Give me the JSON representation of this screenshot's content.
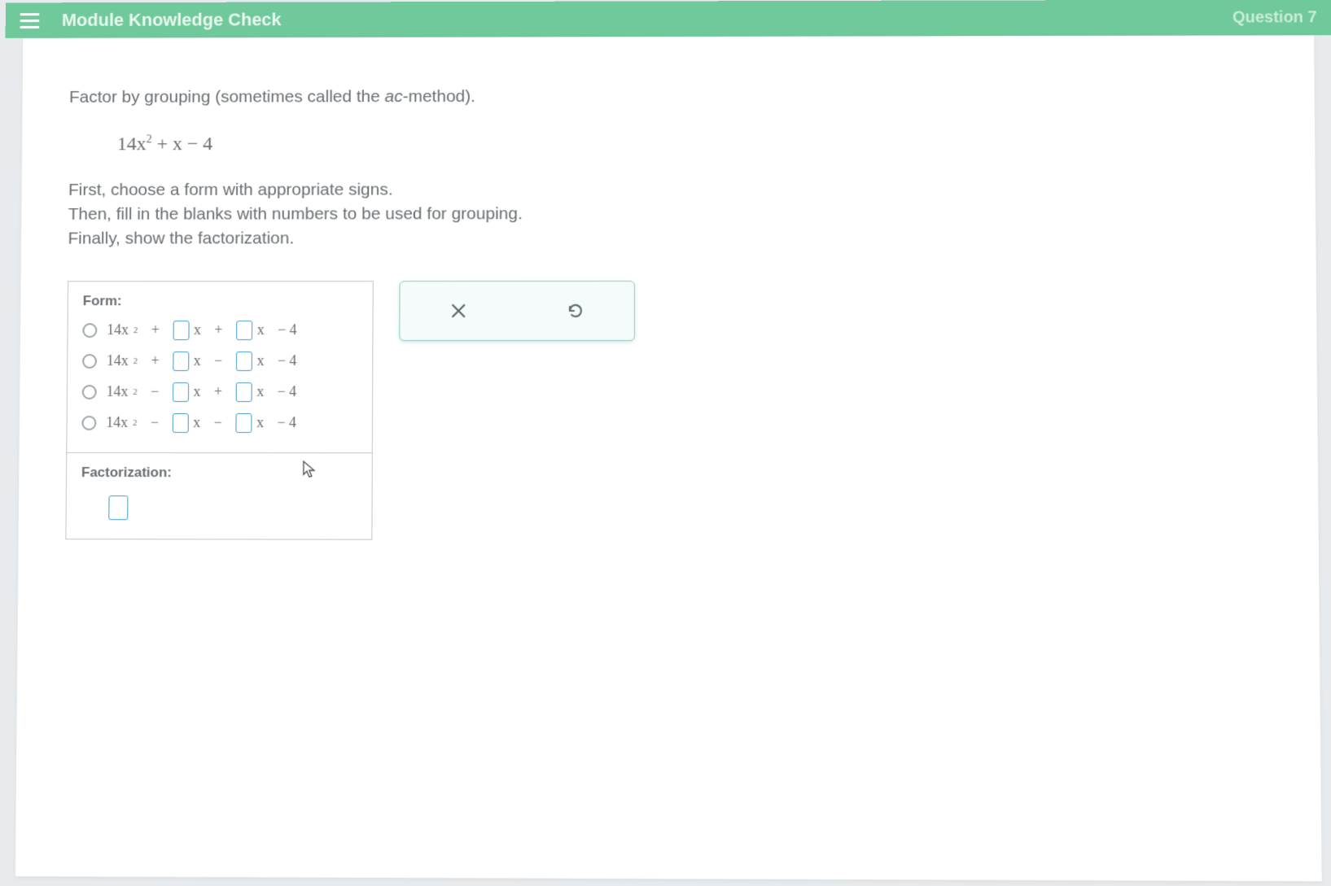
{
  "header": {
    "title": "Module Knowledge Check",
    "question_label": "Question 7"
  },
  "question": {
    "prompt_prefix": "Factor by grouping (sometimes called the ",
    "prompt_method": "ac",
    "prompt_suffix": "-method).",
    "expression_lead": "14x",
    "expression_exp": "2",
    "expression_tail": " + x − 4",
    "instructions_line1": "First, choose a form with appropriate signs.",
    "instructions_line2": "Then, fill in the blanks with numbers to be used for grouping.",
    "instructions_line3": "Finally, show the factorization."
  },
  "panel": {
    "form_label": "Form:",
    "factorization_label": "Factorization:",
    "options": [
      {
        "lead": "14x",
        "exp": "2",
        "op1": "+",
        "op2": "+",
        "tail": "− 4"
      },
      {
        "lead": "14x",
        "exp": "2",
        "op1": "+",
        "op2": "−",
        "tail": "− 4"
      },
      {
        "lead": "14x",
        "exp": "2",
        "op1": "−",
        "op2": "+",
        "tail": "− 4"
      },
      {
        "lead": "14x",
        "exp": "2",
        "op1": "−",
        "op2": "−",
        "tail": "− 4"
      }
    ],
    "x_var": "x"
  },
  "toolbox": {
    "clear_name": "clear",
    "reset_name": "reset"
  }
}
